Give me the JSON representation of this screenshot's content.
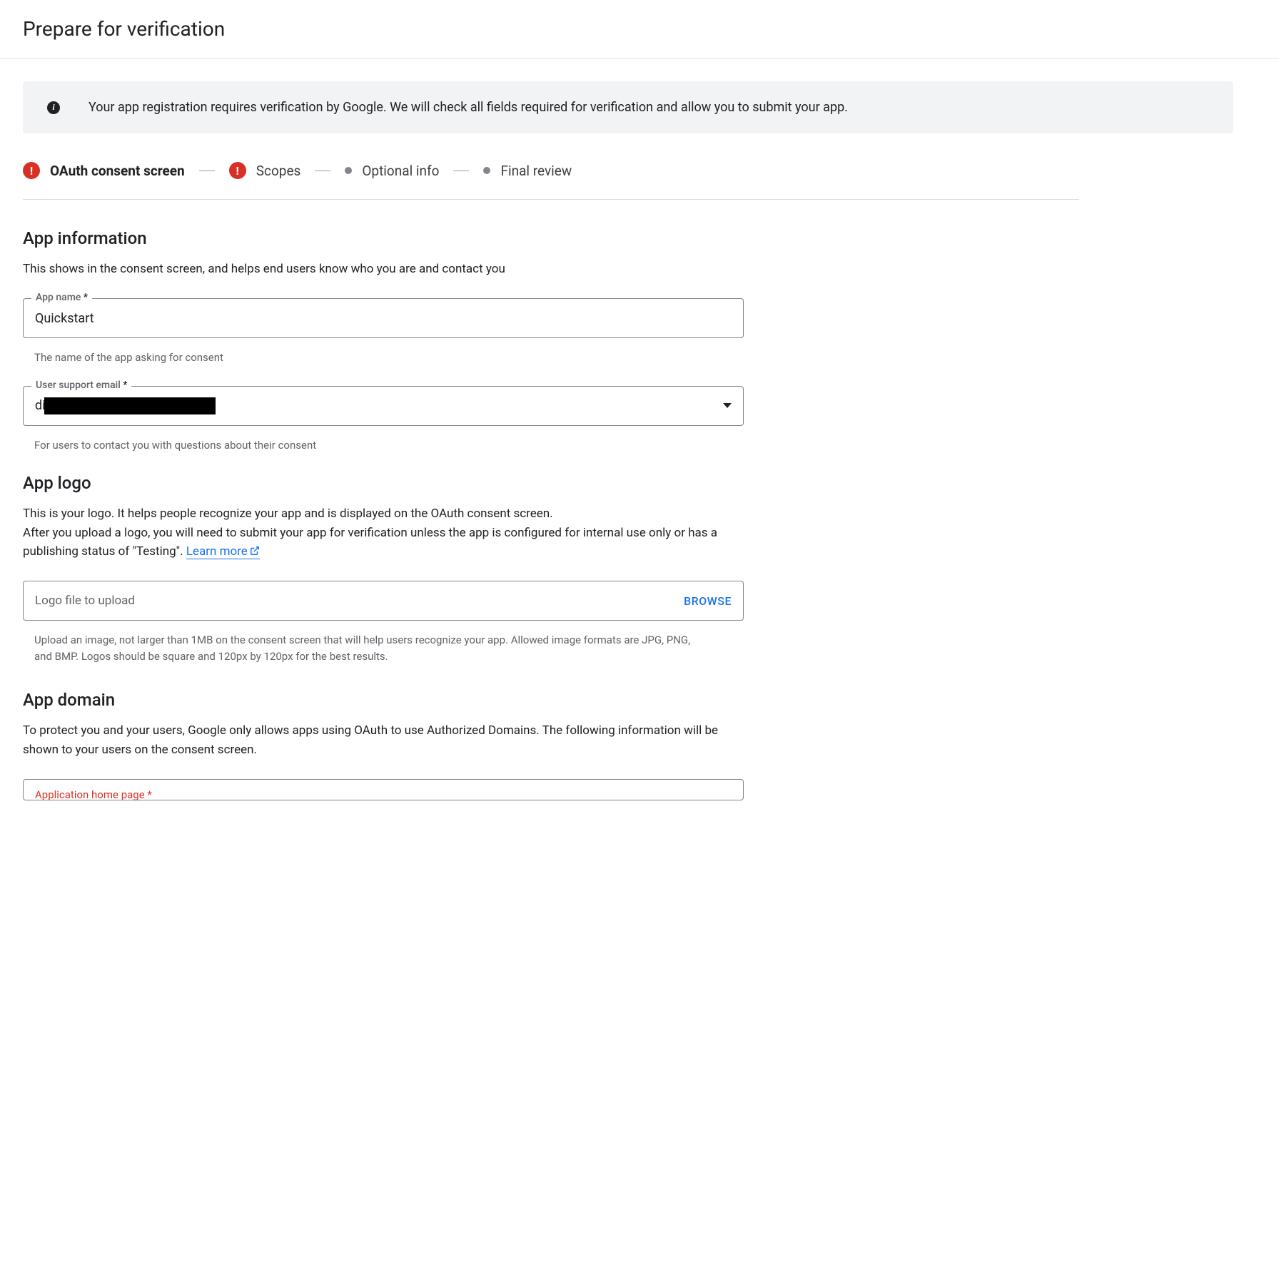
{
  "header": {
    "title": "Prepare for verification"
  },
  "banner": {
    "text": "Your app registration requires verification by Google. We will check all fields required for verification and allow you to submit your app."
  },
  "stepper": {
    "step1": "OAuth consent screen",
    "step2": "Scopes",
    "step3": "Optional info",
    "step4": "Final review"
  },
  "appInfo": {
    "heading": "App information",
    "desc": "This shows in the consent screen, and helps end users know who you are and contact you",
    "appName": {
      "label": "App name",
      "value": "Quickstart",
      "helper": "The name of the app asking for consent"
    },
    "supportEmail": {
      "label": "User support email",
      "valuePrefix": "di",
      "helper": "For users to contact you with questions about their consent"
    }
  },
  "appLogo": {
    "heading": "App logo",
    "desc1": "This is your logo. It helps people recognize your app and is displayed on the OAuth consent screen.",
    "desc2a": "After you upload a logo, you will need to submit your app for verification unless the app is configured for internal use only or has a publishing status of \"Testing\". ",
    "learnMore": "Learn more",
    "file": {
      "placeholder": "Logo file to upload",
      "browse": "BROWSE",
      "helper": "Upload an image, not larger than 1MB on the consent screen that will help users recognize your app. Allowed image formats are JPG, PNG, and BMP. Logos should be square and 120px by 120px for the best results."
    }
  },
  "appDomain": {
    "heading": "App domain",
    "desc": "To protect you and your users, Google only allows apps using OAuth to use Authorized Domains. The following information will be shown to your users on the consent screen.",
    "homepage": {
      "label": "Application home page"
    }
  }
}
